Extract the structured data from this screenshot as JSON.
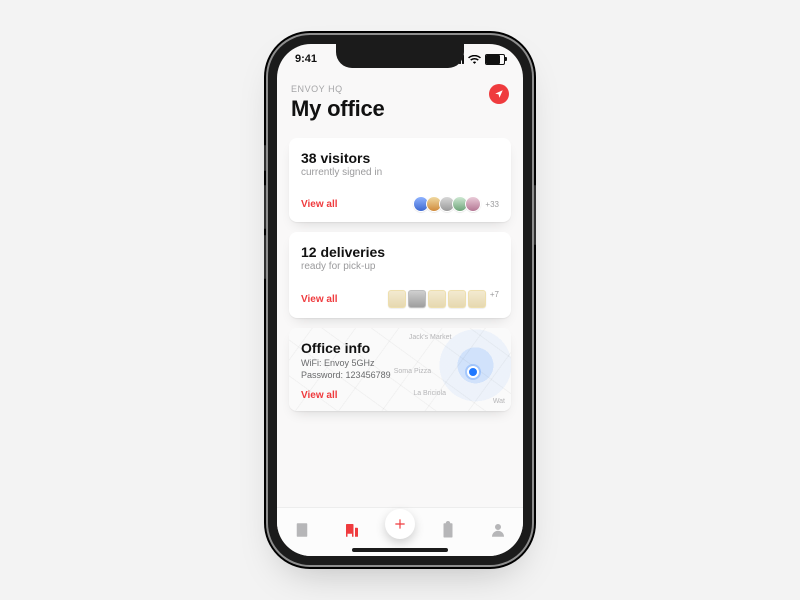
{
  "status": {
    "time": "9:41"
  },
  "header": {
    "eyebrow": "ENVOY HQ",
    "title": "My office"
  },
  "visitors": {
    "title": "38 visitors",
    "subtitle": "currently signed in",
    "view_all": "View all",
    "more": "+33"
  },
  "deliveries": {
    "title": "12 deliveries",
    "subtitle": "ready for pick-up",
    "view_all": "View all",
    "more": "+7"
  },
  "office": {
    "title": "Office info",
    "wifi_label": "WiFi:",
    "wifi_value": "Envoy 5GHz",
    "pwd_label": "Password:",
    "pwd_value": "123456789",
    "view_all": "View all",
    "poi": {
      "a": "Jack's Market",
      "b": "",
      "c": "Soma Pizza",
      "d": "La Briciola",
      "e": "Wat"
    }
  },
  "colors": {
    "accent": "#ef3b3e"
  }
}
